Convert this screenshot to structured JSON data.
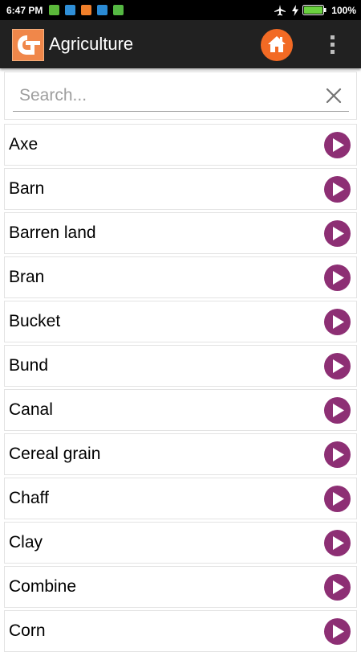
{
  "status_bar": {
    "time": "6:47 PM",
    "battery_percent": "100%",
    "notification_icons": [
      "app-notification-icon",
      "chat-notification-icon",
      "mail-notification-icon",
      "vpn-notification-icon",
      "android-notification-icon"
    ],
    "system_icons": [
      "airplane-mode-icon",
      "charging-icon",
      "battery-icon"
    ]
  },
  "app_bar": {
    "title": "Agriculture",
    "logo_icon": "app-logo-icon",
    "home_icon": "home-icon",
    "menu_icon": "more-vert-icon",
    "accent_color": "#f26a24",
    "background_color": "#212121"
  },
  "search": {
    "placeholder": "Search...",
    "value": "",
    "clear_icon": "close-icon"
  },
  "list": {
    "play_icon": "play-icon",
    "play_color": "#8d2f74",
    "items": [
      {
        "label": "Axe"
      },
      {
        "label": "Barn"
      },
      {
        "label": "Barren land"
      },
      {
        "label": "Bran"
      },
      {
        "label": "Bucket"
      },
      {
        "label": "Bund"
      },
      {
        "label": "Canal"
      },
      {
        "label": "Cereal grain"
      },
      {
        "label": "Chaff"
      },
      {
        "label": "Clay"
      },
      {
        "label": "Combine"
      },
      {
        "label": "Corn"
      }
    ]
  }
}
